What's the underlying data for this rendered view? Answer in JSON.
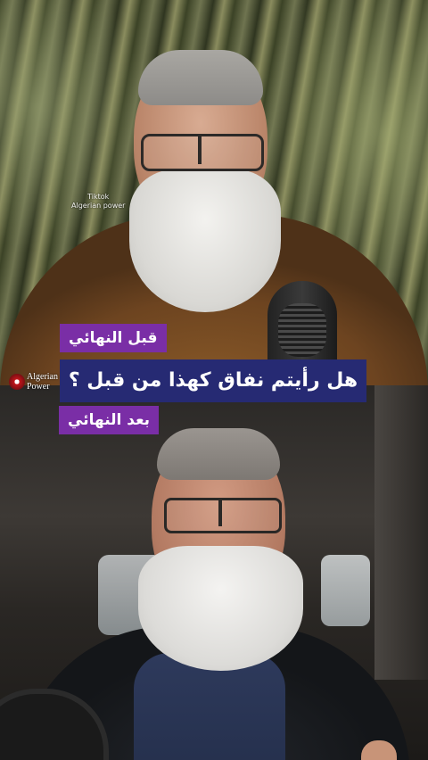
{
  "overlay": {
    "label_before": "قبل النهائي",
    "headline": "هل رأيتم نفاق كهذا من قبل ؟",
    "label_after": "بعد النهائي"
  },
  "brand": {
    "line1": "Algerian",
    "line2": "Power"
  },
  "watermark": {
    "line1": "Tiktok",
    "line2": "Algerian power"
  },
  "colors": {
    "label_bg": "#7a2ea6",
    "headline_bg": "#262a73",
    "text": "#ffffff"
  }
}
